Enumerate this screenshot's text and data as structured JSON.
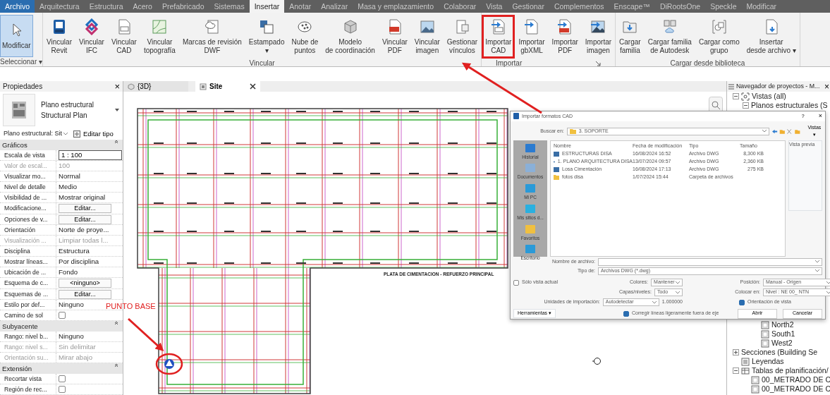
{
  "menu_tabs": [
    {
      "label": "Archivo",
      "kind": "file",
      "selected": false
    },
    {
      "label": "Arquitectura",
      "kind": "tab",
      "selected": false
    },
    {
      "label": "Estructura",
      "kind": "tab",
      "selected": false
    },
    {
      "label": "Acero",
      "kind": "tab",
      "selected": false
    },
    {
      "label": "Prefabricado",
      "kind": "tab",
      "selected": false
    },
    {
      "label": "Sistemas",
      "kind": "tab",
      "selected": false
    },
    {
      "label": "Insertar",
      "kind": "tab",
      "selected": true
    },
    {
      "label": "Anotar",
      "kind": "tab",
      "selected": false
    },
    {
      "label": "Analizar",
      "kind": "tab",
      "selected": false
    },
    {
      "label": "Masa y emplazamiento",
      "kind": "tab",
      "selected": false
    },
    {
      "label": "Colaborar",
      "kind": "tab",
      "selected": false
    },
    {
      "label": "Vista",
      "kind": "tab",
      "selected": false
    },
    {
      "label": "Gestionar",
      "kind": "tab",
      "selected": false
    },
    {
      "label": "Complementos",
      "kind": "tab",
      "selected": false
    },
    {
      "label": "Enscape™",
      "kind": "tab",
      "selected": false
    },
    {
      "label": "DiRootsOne",
      "kind": "tab",
      "selected": false
    },
    {
      "label": "Speckle",
      "kind": "tab",
      "selected": false
    },
    {
      "label": "Modificar",
      "kind": "tab",
      "selected": false
    }
  ],
  "ribbon_groups": [
    {
      "label": "Seleccionar ▾",
      "launcher": false,
      "buttons": [
        {
          "label": "Modificar",
          "kind": "cursor",
          "selected": true,
          "highlighted": false
        }
      ]
    },
    {
      "label": "Vincular",
      "launcher": false,
      "buttons": [
        {
          "label": "Vincular\nRevit",
          "kind": "revit",
          "selected": false,
          "highlighted": false
        },
        {
          "label": "Vincular\nIFC",
          "kind": "ifc",
          "selected": false,
          "highlighted": false
        },
        {
          "label": "Vincular\nCAD",
          "kind": "cad",
          "selected": false,
          "highlighted": false
        },
        {
          "label": "Vincular\ntopografía",
          "kind": "topo",
          "selected": false,
          "highlighted": false
        },
        {
          "label": "Marcas de revisión\nDWF",
          "kind": "markup",
          "selected": false,
          "highlighted": false
        },
        {
          "label": "Estampado\n▾",
          "kind": "stamp",
          "selected": false,
          "highlighted": false
        },
        {
          "label": "Nube de\npuntos",
          "kind": "cloud",
          "selected": false,
          "highlighted": false
        },
        {
          "label": "Modelo\nde coordinación",
          "kind": "cube",
          "selected": false,
          "highlighted": false
        },
        {
          "label": "Vincular\nPDF",
          "kind": "pdf",
          "selected": false,
          "highlighted": false
        },
        {
          "label": "Vincular\nimagen",
          "kind": "image",
          "selected": false,
          "highlighted": false
        },
        {
          "label": "Gestionar\nvínculos",
          "kind": "manage",
          "selected": false,
          "highlighted": false
        }
      ]
    },
    {
      "label": "Importar",
      "launcher": true,
      "buttons": [
        {
          "label": "Importar\nCAD",
          "kind": "import-cad",
          "selected": false,
          "highlighted": true
        },
        {
          "label": "Importar\ngbXML",
          "kind": "import-doc",
          "selected": false,
          "highlighted": false
        },
        {
          "label": "Importar\nPDF",
          "kind": "import-pdf",
          "selected": false,
          "highlighted": false
        },
        {
          "label": "Importar\nimagen",
          "kind": "import-image",
          "selected": false,
          "highlighted": false
        }
      ]
    },
    {
      "label": "Cargar desde biblioteca",
      "launcher": false,
      "buttons": [
        {
          "label": "Cargar\nfamilia",
          "kind": "folder",
          "selected": false,
          "highlighted": false
        },
        {
          "label": "Cargar familia\nde Autodesk",
          "kind": "autodesk",
          "selected": false,
          "highlighted": false
        },
        {
          "label": "Cargar como\ngrupo",
          "kind": "group",
          "selected": false,
          "highlighted": false
        },
        {
          "label": "Insertar\ndesde archivo ▾",
          "kind": "insert",
          "selected": false,
          "highlighted": false
        }
      ]
    }
  ],
  "properties": {
    "title": "Propiedades",
    "close": "×",
    "type_name": "Plano estructural\nStructural Plan",
    "instance_selector": "Plano estructural: Sit",
    "edit_type": "Editar tipo",
    "sections": [
      {
        "title": "Gráficos",
        "rows": [
          {
            "label": "Escala de vista",
            "value": "1 : 100",
            "kind": "input",
            "disabled": false
          },
          {
            "label": "Valor de escal...",
            "value": "100",
            "kind": "text",
            "disabled": true
          },
          {
            "label": "Visualizar mo...",
            "value": "Normal",
            "kind": "text",
            "disabled": false
          },
          {
            "label": "Nivel de detalle",
            "value": "Medio",
            "kind": "text",
            "disabled": false
          },
          {
            "label": "Visibilidad de ...",
            "value": "Mostrar original",
            "kind": "text",
            "disabled": false
          },
          {
            "label": "Modificacione...",
            "value": "Editar...",
            "kind": "button",
            "disabled": false
          },
          {
            "label": "Opciones de v...",
            "value": "Editar...",
            "kind": "button",
            "disabled": false
          },
          {
            "label": "Orientación",
            "value": "Norte de proye...",
            "kind": "text",
            "disabled": false
          },
          {
            "label": "Visualización ...",
            "value": "Limpiar todas l...",
            "kind": "text",
            "disabled": true
          },
          {
            "label": "Disciplina",
            "value": "Estructura",
            "kind": "text",
            "disabled": false
          },
          {
            "label": "Mostrar líneas...",
            "value": "Por disciplina",
            "kind": "text",
            "disabled": false
          },
          {
            "label": "Ubicación de ...",
            "value": "Fondo",
            "kind": "text",
            "disabled": false
          },
          {
            "label": "Esquema de c...",
            "value": "<ninguno>",
            "kind": "button",
            "disabled": false
          },
          {
            "label": "Esquemas de ...",
            "value": "Editar...",
            "kind": "button",
            "disabled": false
          },
          {
            "label": "Estilo por def...",
            "value": "Ninguno",
            "kind": "text",
            "disabled": false
          },
          {
            "label": "Camino de sol",
            "kind": "check",
            "checked": false,
            "disabled": false
          }
        ]
      },
      {
        "title": "Subyacente",
        "rows": [
          {
            "label": "Rango: nivel b...",
            "value": "Ninguno",
            "kind": "text",
            "disabled": false
          },
          {
            "label": "Rango: nivel s...",
            "value": "Sin delimitar",
            "kind": "text",
            "disabled": true
          },
          {
            "label": "Orientación su...",
            "value": "Mirar abajo",
            "kind": "text",
            "disabled": true
          }
        ]
      },
      {
        "title": "Extensión",
        "rows": [
          {
            "label": "Recortar vista",
            "kind": "check",
            "checked": false,
            "disabled": false
          },
          {
            "label": "Región de rec...",
            "kind": "check",
            "checked": false,
            "disabled": false
          }
        ]
      }
    ]
  },
  "view_tabs": [
    {
      "label": "{3D}",
      "kind": "model",
      "selected": false
    },
    {
      "label": "Site",
      "kind": "plan",
      "selected": true
    }
  ],
  "drawing": {
    "title": "PLATA DE CIMENTACION - REFUERZO PRINCIPAL",
    "base_point_label": "PUNTO BASE"
  },
  "dialog": {
    "title": "Importar formatos CAD",
    "help": "?",
    "close": "×",
    "look_in_label": "Buscar en:",
    "look_in": "3. SOPORTE",
    "views": "Vistas ▾",
    "places": [
      "Historial",
      "Documentos",
      "Mi PC",
      "Mis sitios d...",
      "Favoritos",
      "Escritorio"
    ],
    "columns": [
      "Nombre",
      "Fecha de modificación",
      "Tipo",
      "Tamaño"
    ],
    "files": [
      {
        "kind": "dwg",
        "name": "ESTRUCTURAS DISA",
        "date": "16/08/2024 16:52",
        "type": "Archivo DWG",
        "size": "8,300 KB"
      },
      {
        "kind": "dwg",
        "name": "1. PLANO ARQUITECTURA DISA",
        "date": "13/07/2024 09:57",
        "type": "Archivo DWG",
        "size": "2,360 KB"
      },
      {
        "kind": "dwg",
        "name": "Losa Cimentación",
        "date": "16/08/2024 17:13",
        "type": "Archivo DWG",
        "size": "275 KB"
      },
      {
        "kind": "folder",
        "name": "fotos disa",
        "date": "1/07/2024 15:44",
        "type": "Carpeta de archivos"
      }
    ],
    "preview_label": "Vista previa",
    "file_name_label": "Nombre de archivo:",
    "file_type_label": "Tipo de:",
    "file_type": "Archivos DWG (*.dwg)",
    "current_view_only": {
      "label": "Sólo vista actual",
      "checked": false
    },
    "colors_label": "Colores:",
    "colors": "Mantener",
    "layers_label": "Capas/niveles:",
    "layers": "Todo",
    "units_label": "Unidades de importación:",
    "units": "Autodetectar",
    "units_factor": "1.000000",
    "position_label": "Posición:",
    "position": "Manual - Origen",
    "place_at_label": "Colocar en:",
    "place_at": "Nivel : NE 00_ NTN",
    "orient_view": {
      "label": "Orientación de vista",
      "checked": true
    },
    "correct_lines": {
      "label": "Corregir líneas ligeramente fuera de eje",
      "checked": true
    },
    "tools": "Herramientas ▾",
    "buttons": [
      "Abrir",
      "Cancelar"
    ]
  },
  "navigator": {
    "title": "Navegador de proyectos - M...",
    "close": "×",
    "tree_top": [
      {
        "label": "Vistas (all)",
        "kind": "views",
        "expanded": true,
        "children": [
          {
            "label": "Planos estructurales (S",
            "expanded": true
          }
        ]
      }
    ],
    "tree_elevations": [
      {
        "label": "North2",
        "kind": "view"
      },
      {
        "label": "South1",
        "kind": "view"
      },
      {
        "label": "West2",
        "kind": "view"
      }
    ],
    "tree_bottom": [
      {
        "label": "Secciones (Building Se",
        "expanded": false
      },
      {
        "label": "Leyendas",
        "kind": "legend"
      },
      {
        "label": "Tablas de planificación/",
        "kind": "schedules",
        "expanded": true,
        "children": [
          {
            "label": "00_METRADO DE C",
            "kind": "view"
          },
          {
            "label": "00_METRADO DE C",
            "kind": "view"
          }
        ]
      }
    ]
  }
}
